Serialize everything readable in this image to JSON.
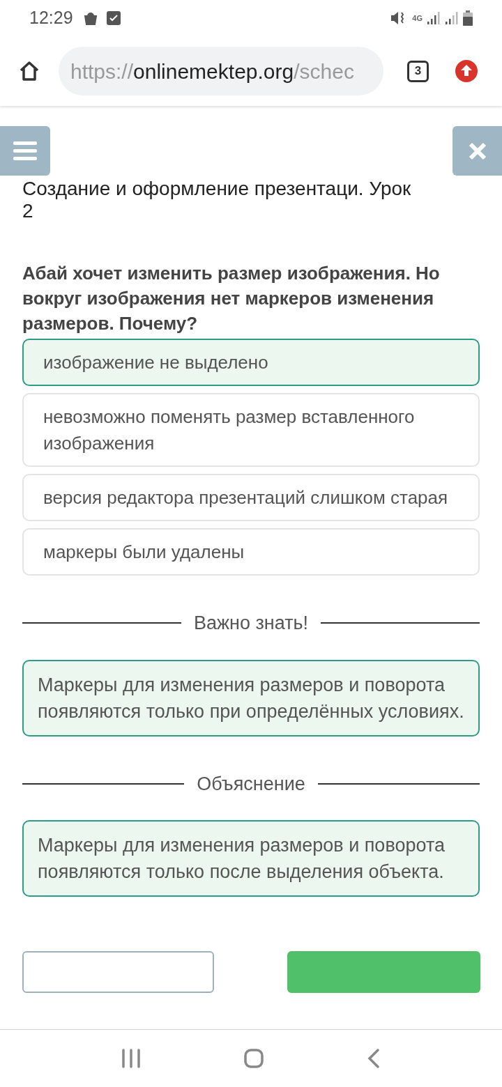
{
  "status_bar": {
    "time": "12:29",
    "network": "4G"
  },
  "browser": {
    "url": {
      "scheme": "https://",
      "host": "onlinemektep.org",
      "path": "/schec"
    },
    "tab_count": "3"
  },
  "lesson": {
    "title": "Создание и оформление презентаци. Урок 2"
  },
  "question": {
    "text": "Абай хочет изменить размер изображения. Но вокруг изображения нет маркеров изменения размеров. Почему?",
    "options": [
      {
        "label": "изображение не выделено",
        "selected": true
      },
      {
        "label": "невозможно поменять размер вставленного изображения",
        "selected": false
      },
      {
        "label": "версия редактора презентаций слишком старая",
        "selected": false
      },
      {
        "label": "маркеры были удалены",
        "selected": false
      }
    ]
  },
  "sections": [
    {
      "heading": "Важно знать!",
      "text": "Маркеры для изменения размеров и поворота появляются только при определённых условиях."
    },
    {
      "heading": "Объяснение",
      "text": "Маркеры для изменения размеров и поворота появляются только после выделения объекта."
    }
  ]
}
